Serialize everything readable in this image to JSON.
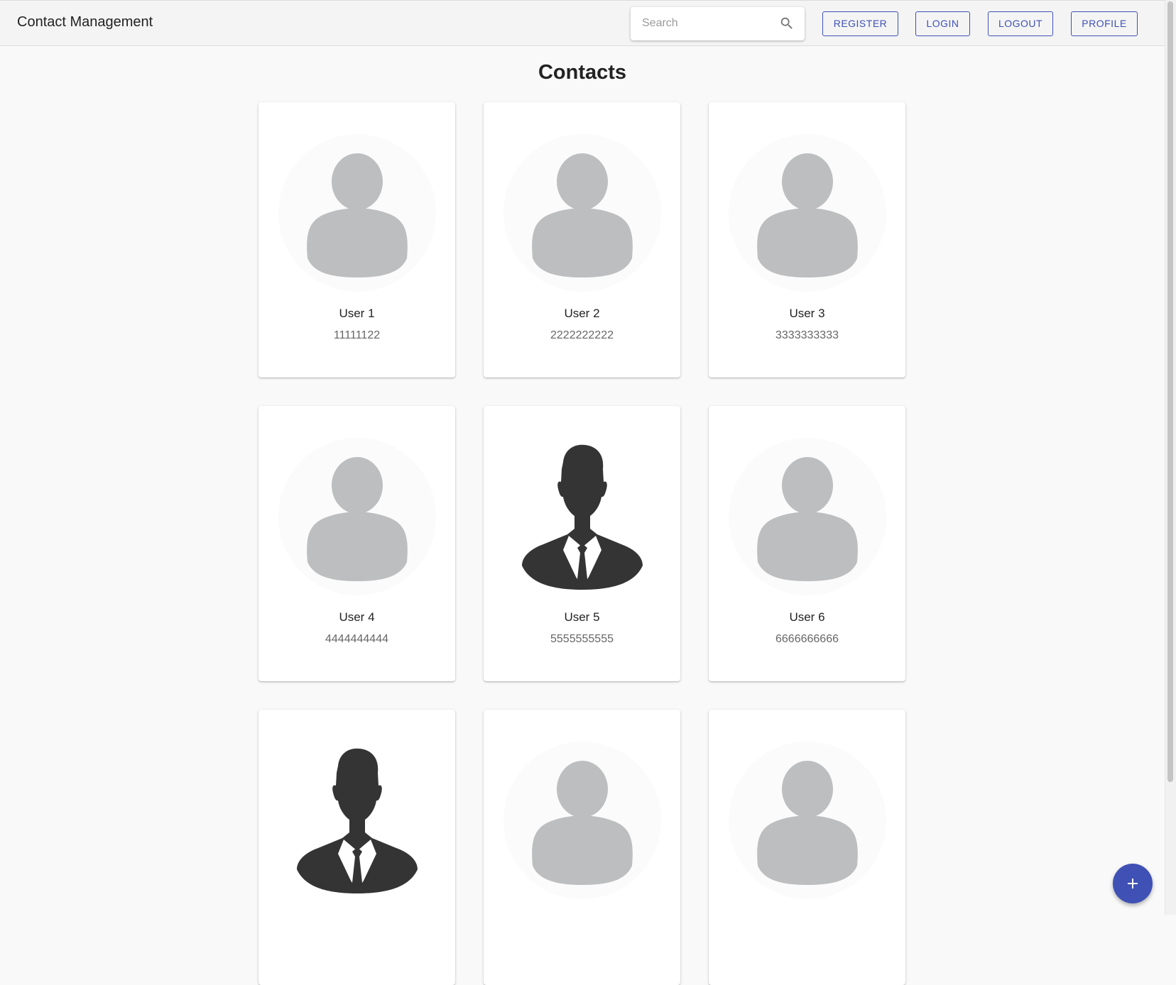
{
  "header": {
    "app_title": "Contact Management",
    "search_placeholder": "Search",
    "search_value": "",
    "nav": {
      "register": "REGISTER",
      "login": "LOGIN",
      "logout": "LOGOUT",
      "profile": "PROFILE"
    }
  },
  "main": {
    "heading": "Contacts",
    "contacts": [
      {
        "name": "User 1",
        "phone": "11111122",
        "avatar": "default-avatar-icon"
      },
      {
        "name": "User 2",
        "phone": "2222222222",
        "avatar": "default-avatar-icon"
      },
      {
        "name": "User 3",
        "phone": "3333333333",
        "avatar": "default-avatar-icon"
      },
      {
        "name": "User 4",
        "phone": "4444444444",
        "avatar": "default-avatar-icon"
      },
      {
        "name": "User 5",
        "phone": "5555555555",
        "avatar": "businessman-avatar-icon"
      },
      {
        "name": "User 6",
        "phone": "6666666666",
        "avatar": "default-avatar-icon"
      },
      {
        "name": "",
        "phone": "",
        "avatar": "businessman-avatar-icon"
      },
      {
        "name": "",
        "phone": "",
        "avatar": "default-avatar-icon"
      },
      {
        "name": "",
        "phone": "",
        "avatar": "default-avatar-icon"
      }
    ]
  },
  "fab": {
    "icon": "plus-icon"
  },
  "colors": {
    "accent": "#3f51b5",
    "header_bg": "#f4f4f4",
    "page_bg": "#f9f9f9",
    "avatar_gray": "#bdbebf",
    "avatar_dark": "#343434"
  }
}
